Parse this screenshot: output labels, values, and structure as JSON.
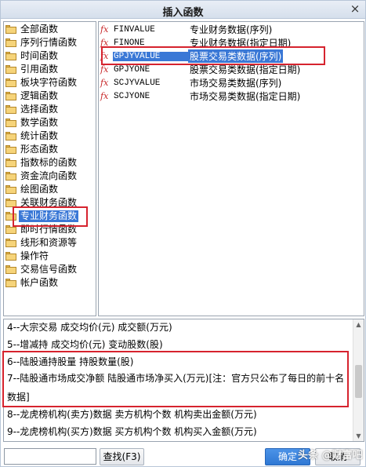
{
  "window": {
    "title": "插入函数",
    "close_symbol": "×"
  },
  "categories": {
    "items": [
      "全部函数",
      "序列行情函数",
      "时间函数",
      "引用函数",
      "板块字符函数",
      "逻辑函数",
      "选择函数",
      "数学函数",
      "统计函数",
      "形态函数",
      "指数标的函数",
      "资金流向函数",
      "绘图函数",
      "关联财务函数",
      "专业财务函数",
      "即时行情函数",
      "线形和资源等",
      "操作符",
      "交易信号函数",
      "帐户函数"
    ],
    "selected": "专业财务函数"
  },
  "functions": {
    "items": [
      {
        "name": "FINVALUE",
        "desc": "专业财务数据(序列)"
      },
      {
        "name": "FINONE",
        "desc": "专业财务数据(指定日期)"
      },
      {
        "name": "GPJYVALUE",
        "desc": "股票交易类数据(序列)"
      },
      {
        "name": "GPJYONE",
        "desc": "股票交易类数据(指定日期)"
      },
      {
        "name": "SCJYVALUE",
        "desc": "市场交易类数据(序列)"
      },
      {
        "name": "SCJYONE",
        "desc": "市场交易类数据(指定日期)"
      }
    ],
    "selected": "GPJYVALUE",
    "fx_label": "fx"
  },
  "description": {
    "lines": [
      "4--大宗交易  成交均价(元) 成交额(万元)",
      "5--增减持   成交均价(元) 变动股数(股)",
      "6--陆股通持股量  持股数量(股)",
      "7--陆股通市场成交净额  陆股通市场净买入(万元)[注：官方只公布了每日的前十名",
      "数据]",
      "8--龙虎榜机构(卖方)数据  卖方机构个数 机构卖出金额(万元)",
      "9--龙虎榜机构(买方)数据  买方机构个数 机构买入金额(万元)"
    ]
  },
  "bottom": {
    "search_value": "",
    "search_label": "查找(F3)",
    "ok_label": "确定",
    "cancel_label": "取消"
  },
  "watermark": "头条 @财富吧",
  "colors": {
    "highlight": "#3a78d6",
    "annotation_red": "#d6232e",
    "fx_red": "#c8282a"
  },
  "icons": {
    "category_item": "folder-icon",
    "function_item": "fx-icon"
  }
}
